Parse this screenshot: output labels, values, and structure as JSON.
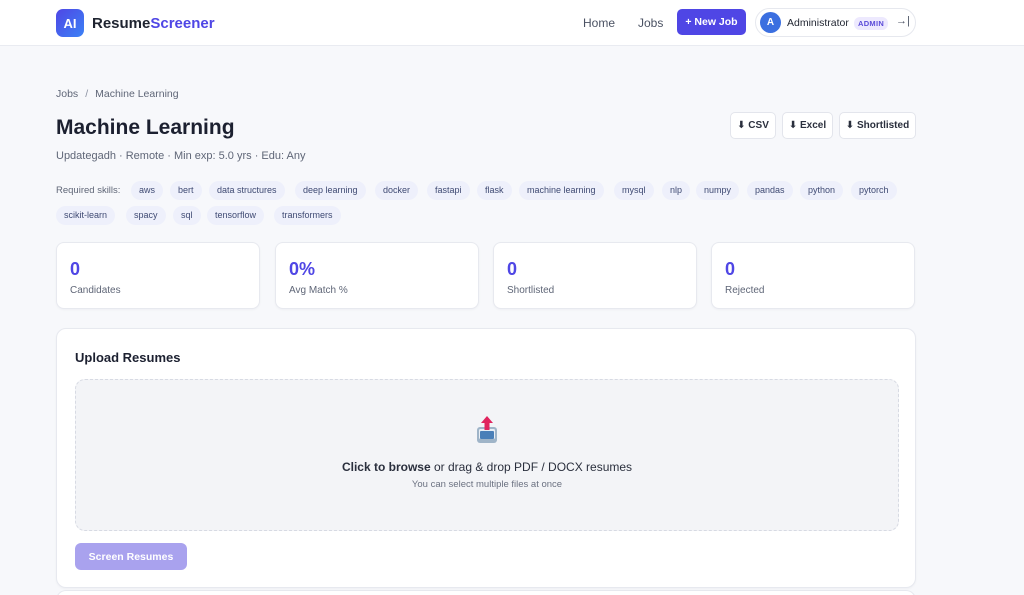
{
  "brand": {
    "logo_text": "AI",
    "name_part1": "Resume",
    "name_part2": "Screener",
    "accent_color": "#4f46e5"
  },
  "nav": {
    "home_label": "Home",
    "jobs_label": "Jobs",
    "new_job_label": "+ New Job",
    "user": {
      "avatar_initial": "A",
      "name": "Administrator",
      "role": "ADMIN",
      "logout_icon": "→|"
    }
  },
  "breadcrumb": {
    "root": "Jobs",
    "separator": "/",
    "current": "Machine Learning"
  },
  "job": {
    "title": "Machine Learning",
    "meta": "Updategadh · Remote · Min exp: 5.0 yrs · Edu: Any",
    "skills_label": "Required skills:",
    "skills": [
      "aws",
      "bert",
      "data structures",
      "deep learning",
      "docker",
      "fastapi",
      "flask",
      "machine learning",
      "mysql",
      "nlp",
      "numpy",
      "pandas",
      "python",
      "pytorch",
      "scikit-learn",
      "spacy",
      "sql",
      "tensorflow",
      "transformers"
    ]
  },
  "exports": {
    "csv_label": "⬇ CSV",
    "excel_label": "⬇ Excel",
    "shortlisted_label": "⬇ Shortlisted"
  },
  "stats": [
    {
      "value": "0",
      "label": "Candidates"
    },
    {
      "value": "0%",
      "label": "Avg Match %"
    },
    {
      "value": "0",
      "label": "Shortlisted"
    },
    {
      "value": "0",
      "label": "Rejected"
    }
  ],
  "upload": {
    "title": "Upload Resumes",
    "browse_label": "Click to browse",
    "drop_text": " or drag & drop PDF / DOCX resumes",
    "hint": "You can select multiple files at once",
    "screen_button_label": "Screen Resumes",
    "icon": "upload-tray-icon"
  }
}
